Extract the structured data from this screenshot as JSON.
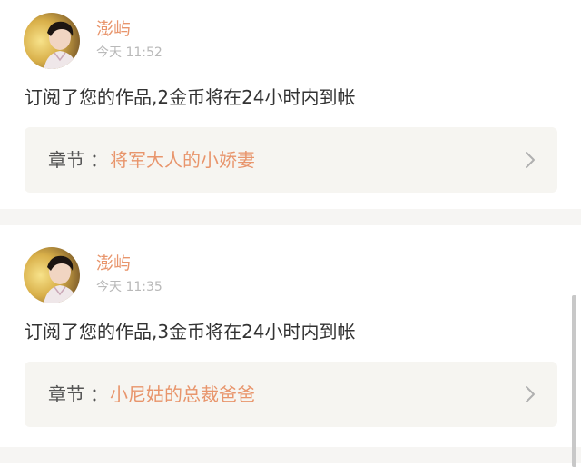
{
  "colors": {
    "accent": "#e8956c",
    "text": "#333333",
    "muted": "#b9b9b9",
    "panel": "#f6f5f1",
    "separator": "#f6f5f3"
  },
  "notifications": [
    {
      "username": "澎屿",
      "timestamp": "今天 11:52",
      "message": "订阅了您的作品,2金币将在24小时内到帐",
      "chapter_label": "章节",
      "chapter_colon": "：",
      "chapter_title": "将军大人的小娇妻",
      "avatar_icon": "user-avatar",
      "chevron_icon": "chevron-right-icon"
    },
    {
      "username": "澎屿",
      "timestamp": "今天 11:35",
      "message": "订阅了您的作品,3金币将在24小时内到帐",
      "chapter_label": "章节",
      "chapter_colon": "：",
      "chapter_title": "小尼姑的总裁爸爸",
      "avatar_icon": "user-avatar",
      "chevron_icon": "chevron-right-icon"
    }
  ]
}
